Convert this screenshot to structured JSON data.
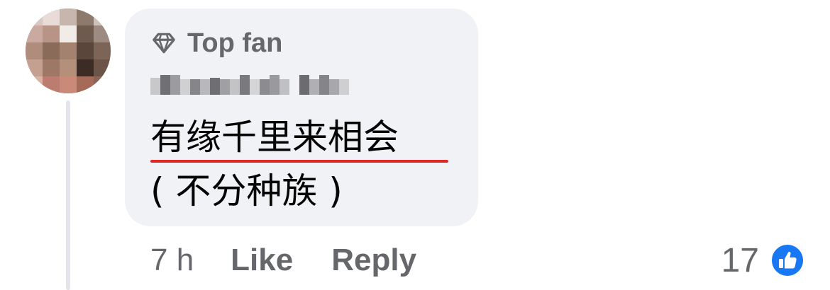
{
  "comment": {
    "badge_label": "Top fan",
    "badge_icon": "diamond-icon",
    "text_line1": "有缘千里来相会",
    "text_line2": "( 不分种族 )",
    "timestamp": "7 h",
    "actions": {
      "like_label": "Like",
      "reply_label": "Reply"
    },
    "reactions": {
      "count": "17",
      "icon": "like-thumb-icon"
    }
  },
  "colors": {
    "bubble_bg": "#f0f2f5",
    "secondary_text": "#65676b",
    "primary_text": "#050505",
    "like_blue": "#1877f2",
    "spellcheck_red": "#e02828"
  }
}
